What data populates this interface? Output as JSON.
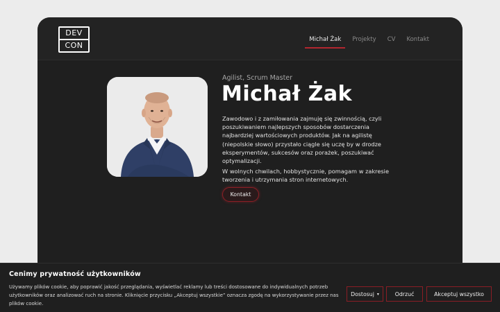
{
  "header": {
    "logo_top": "DEV",
    "logo_bottom": "CON",
    "nav": [
      "Michał Żak",
      "Projekty",
      "CV",
      "Kontakt"
    ]
  },
  "profile": {
    "subtitle": "Agilist, Scrum Master",
    "name": "Michał Żak",
    "bio": "Zawodowo i z zamiłowania zajmuję się zwinnością, czyli poszukiwaniem najlepszych sposobów dostarczenia najbardziej wartościowych produktów. Jak na agilistę (niepolskie słowo) przystało ciągle się uczę by w drodze eksperymentów, sukcesów oraz porażek, poszukiwać optymalizacji.",
    "bio2": "W wolnych chwilach, hobbystycznie, pomagam w zakresie tworzenia i utrzymania stron internetowych.",
    "contact_button": "Kontakt"
  },
  "cookie": {
    "title": "Cenimy prywatność użytkowników",
    "text": "Używamy plików cookie, aby poprawić jakość przeglądania, wyświetlać reklamy lub treści dostosowane do indywidualnych potrzeb użytkowników oraz analizować ruch na stronie. Kliknięcie przycisku „Akceptuj wszystkie” oznacza zgodę na wykorzystywanie przez nas plików cookie.",
    "customize": "Dostosuj",
    "reject": "Odrzuć",
    "accept": "Akceptuj wszystko"
  },
  "colors": {
    "accent": "#b3262f",
    "background": "#1f1f1f",
    "page": "#ececec"
  }
}
